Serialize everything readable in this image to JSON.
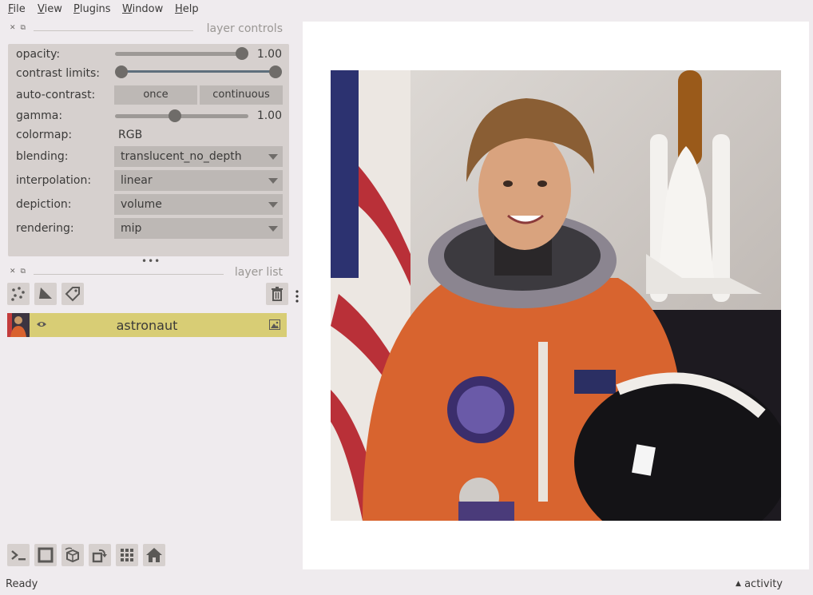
{
  "menubar": {
    "items": [
      {
        "mnemonic": "F",
        "rest": "ile"
      },
      {
        "mnemonic": "V",
        "rest": "iew"
      },
      {
        "mnemonic": "P",
        "rest": "lugins"
      },
      {
        "mnemonic": "W",
        "rest": "indow"
      },
      {
        "mnemonic": "H",
        "rest": "elp"
      }
    ]
  },
  "layer_controls": {
    "title": "layer controls",
    "opacity": {
      "label": "opacity:",
      "value": "1.00",
      "fraction": 1.0
    },
    "contrast_limits": {
      "label": "contrast limits:",
      "low_fraction": 0.0,
      "high_fraction": 1.0
    },
    "auto_contrast": {
      "label": "auto-contrast:",
      "once": "once",
      "continuous": "continuous"
    },
    "gamma": {
      "label": "gamma:",
      "value": "1.00",
      "fraction": 0.45
    },
    "colormap": {
      "label": "colormap:",
      "value": "RGB"
    },
    "blending": {
      "label": "blending:",
      "value": "translucent_no_depth"
    },
    "interpolation": {
      "label": "interpolation:",
      "value": "linear"
    },
    "depiction": {
      "label": "depiction:",
      "value": "volume"
    },
    "rendering": {
      "label": "rendering:",
      "value": "mip"
    },
    "splitter": "•••"
  },
  "layer_list": {
    "title": "layer list",
    "layers": [
      {
        "name": "astronaut",
        "visible": true,
        "type_icon": "image-icon"
      }
    ]
  },
  "bottom_toolbar": {
    "buttons": [
      "console-icon",
      "ndisplay-square-icon",
      "roll-dims-icon",
      "transpose-icon",
      "grid-icon",
      "home-icon"
    ]
  },
  "status": {
    "text": "Ready",
    "activity": "activity"
  },
  "colors": {
    "background": "#efebee",
    "panel": "#d6d0ce",
    "control": "#bdb8b5",
    "selected_layer": "#d8cd75",
    "canvas": "#ffffff"
  }
}
